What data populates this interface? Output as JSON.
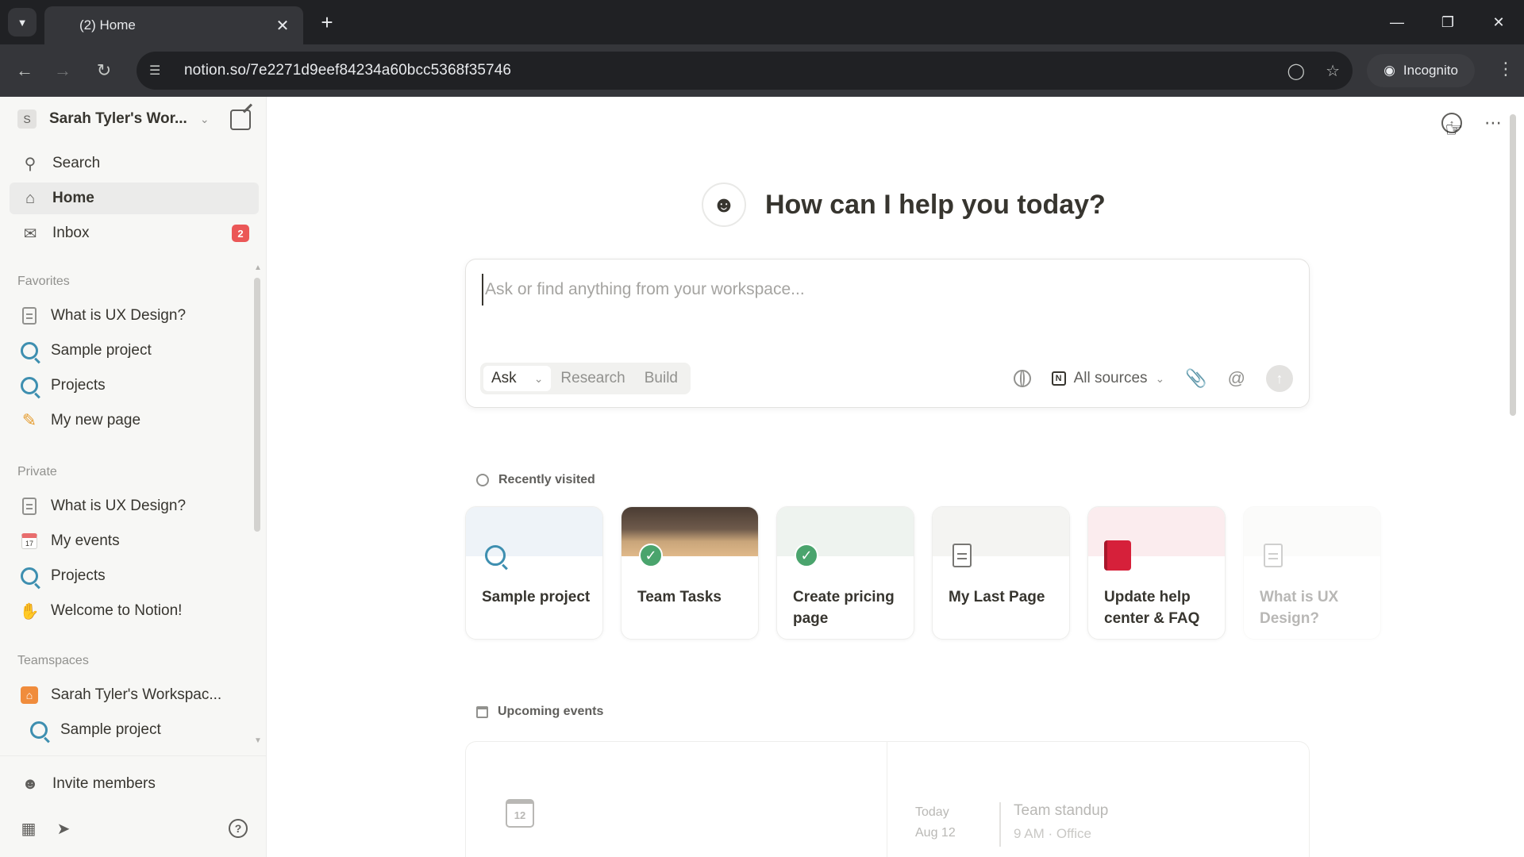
{
  "browser": {
    "tab_title": "(2) Home",
    "url": "notion.so/7e2271d9eef84234a60bcc5368f35746",
    "incognito_label": "Incognito"
  },
  "sidebar": {
    "workspace_name": "Sarah Tyler's Wor...",
    "workspace_initial": "S",
    "nav": {
      "search": "Search",
      "home": "Home",
      "inbox": "Inbox",
      "inbox_badge": "2"
    },
    "favorites_label": "Favorites",
    "favorites": [
      {
        "label": "What is UX Design?",
        "icon": "page-icon"
      },
      {
        "label": "Sample project",
        "icon": "project-icon"
      },
      {
        "label": "Projects",
        "icon": "project-icon"
      },
      {
        "label": "My new page",
        "icon": "pencil-icon"
      }
    ],
    "private_label": "Private",
    "private": [
      {
        "label": "What is UX Design?",
        "icon": "page-icon"
      },
      {
        "label": "My events",
        "icon": "calendar-icon"
      },
      {
        "label": "Projects",
        "icon": "project-icon"
      },
      {
        "label": "Welcome to Notion!",
        "icon": "wave-icon"
      }
    ],
    "teamspaces_label": "Teamspaces",
    "teamspaces": [
      {
        "label": "Sarah Tyler's Workspac...",
        "icon": "house-icon"
      },
      {
        "label": "Sample project",
        "icon": "project-icon"
      }
    ],
    "invite_members": "Invite members"
  },
  "main": {
    "greeting": "How can I help you today?",
    "ask": {
      "placeholder": "Ask or find anything from your workspace...",
      "mode_selected": "Ask",
      "mode_research": "Research",
      "mode_build": "Build",
      "sources": "All sources"
    },
    "recently_visited_label": "Recently visited",
    "recent": [
      {
        "title": "Sample project",
        "icon": "project-icon"
      },
      {
        "title": "Team Tasks",
        "icon": "check-icon"
      },
      {
        "title": "Create pricing page",
        "icon": "check-icon"
      },
      {
        "title": "My Last Page",
        "icon": "page-icon"
      },
      {
        "title": "Update help center & FAQ",
        "icon": "book-icon"
      },
      {
        "title": "What is UX Design?",
        "icon": "page-icon"
      }
    ],
    "upcoming_events_label": "Upcoming events",
    "calendar_day": "12",
    "event": {
      "day_label": "Today",
      "date": "Aug 12",
      "title": "Team standup",
      "meta": "9 AM · Office"
    }
  },
  "colors": {
    "sidebar_bg": "#f7f7f5",
    "badge_red": "#eb5757",
    "chrome_dark": "#202124",
    "check_green": "#4aa46d"
  }
}
